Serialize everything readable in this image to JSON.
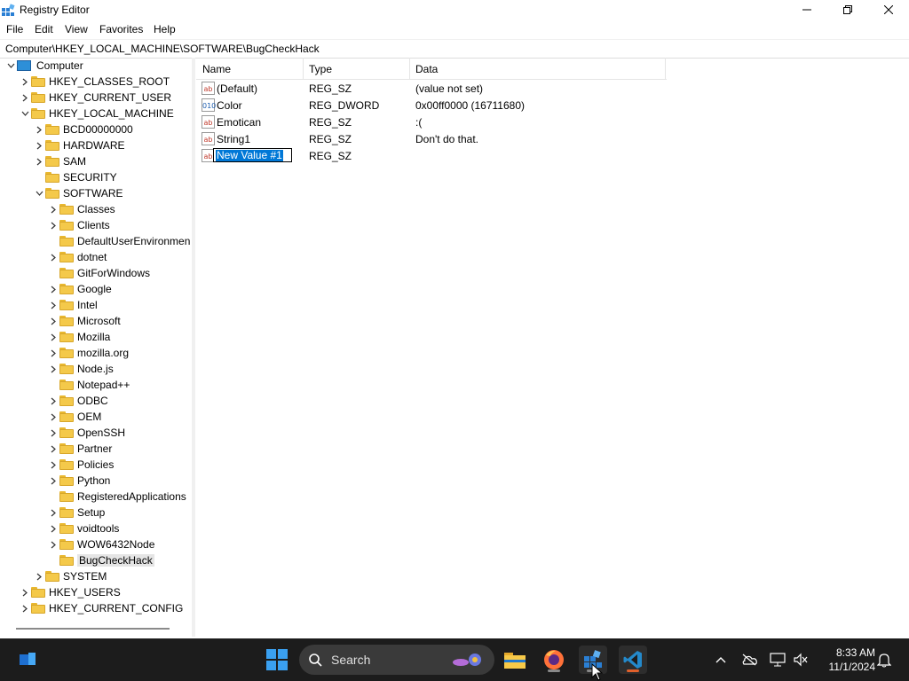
{
  "window": {
    "title": "Registry Editor"
  },
  "menu": [
    "File",
    "Edit",
    "View",
    "Favorites",
    "Help"
  ],
  "address": "Computer\\HKEY_LOCAL_MACHINE\\SOFTWARE\\BugCheckHack",
  "tree": [
    {
      "label": "Computer",
      "level": 0,
      "chevron": "expanded",
      "icon": "computer-icon"
    },
    {
      "label": "HKEY_CLASSES_ROOT",
      "level": 1,
      "chevron": "collapsed"
    },
    {
      "label": "HKEY_CURRENT_USER",
      "level": 1,
      "chevron": "collapsed"
    },
    {
      "label": "HKEY_LOCAL_MACHINE",
      "level": 1,
      "chevron": "expanded"
    },
    {
      "label": "BCD00000000",
      "level": 2,
      "chevron": "collapsed"
    },
    {
      "label": "HARDWARE",
      "level": 2,
      "chevron": "collapsed"
    },
    {
      "label": "SAM",
      "level": 2,
      "chevron": "collapsed"
    },
    {
      "label": "SECURITY",
      "level": 2,
      "chevron": "none"
    },
    {
      "label": "SOFTWARE",
      "level": 2,
      "chevron": "expanded"
    },
    {
      "label": "Classes",
      "level": 3,
      "chevron": "collapsed"
    },
    {
      "label": "Clients",
      "level": 3,
      "chevron": "collapsed"
    },
    {
      "label": "DefaultUserEnvironmen",
      "level": 3,
      "chevron": "none"
    },
    {
      "label": "dotnet",
      "level": 3,
      "chevron": "collapsed"
    },
    {
      "label": "GitForWindows",
      "level": 3,
      "chevron": "none"
    },
    {
      "label": "Google",
      "level": 3,
      "chevron": "collapsed"
    },
    {
      "label": "Intel",
      "level": 3,
      "chevron": "collapsed"
    },
    {
      "label": "Microsoft",
      "level": 3,
      "chevron": "collapsed"
    },
    {
      "label": "Mozilla",
      "level": 3,
      "chevron": "collapsed"
    },
    {
      "label": "mozilla.org",
      "level": 3,
      "chevron": "collapsed"
    },
    {
      "label": "Node.js",
      "level": 3,
      "chevron": "collapsed"
    },
    {
      "label": "Notepad++",
      "level": 3,
      "chevron": "none"
    },
    {
      "label": "ODBC",
      "level": 3,
      "chevron": "collapsed"
    },
    {
      "label": "OEM",
      "level": 3,
      "chevron": "collapsed"
    },
    {
      "label": "OpenSSH",
      "level": 3,
      "chevron": "collapsed"
    },
    {
      "label": "Partner",
      "level": 3,
      "chevron": "collapsed"
    },
    {
      "label": "Policies",
      "level": 3,
      "chevron": "collapsed"
    },
    {
      "label": "Python",
      "level": 3,
      "chevron": "collapsed"
    },
    {
      "label": "RegisteredApplications",
      "level": 3,
      "chevron": "none"
    },
    {
      "label": "Setup",
      "level": 3,
      "chevron": "collapsed"
    },
    {
      "label": "voidtools",
      "level": 3,
      "chevron": "collapsed"
    },
    {
      "label": "WOW6432Node",
      "level": 3,
      "chevron": "collapsed"
    },
    {
      "label": "BugCheckHack",
      "level": 3,
      "chevron": "none",
      "selected": true
    },
    {
      "label": "SYSTEM",
      "level": 2,
      "chevron": "collapsed"
    },
    {
      "label": "HKEY_USERS",
      "level": 1,
      "chevron": "collapsed"
    },
    {
      "label": "HKEY_CURRENT_CONFIG",
      "level": 1,
      "chevron": "collapsed"
    }
  ],
  "list": {
    "columns": [
      "Name",
      "Type",
      "Data"
    ],
    "rows": [
      {
        "icon": "string-value-icon",
        "glyph": "ab",
        "name": "(Default)",
        "type": "REG_SZ",
        "data": "(value not set)"
      },
      {
        "icon": "dword-value-icon",
        "glyph": "010",
        "name": "Color",
        "type": "REG_DWORD",
        "data": "0x00ff0000 (16711680)"
      },
      {
        "icon": "string-value-icon",
        "glyph": "ab",
        "name": "Emotican",
        "type": "REG_SZ",
        "data": ":("
      },
      {
        "icon": "string-value-icon",
        "glyph": "ab",
        "name": "String1",
        "type": "REG_SZ",
        "data": "Don't do that."
      }
    ],
    "editing": {
      "icon": "string-value-icon",
      "glyph": "ab",
      "name": "New Value #1",
      "type": "REG_SZ",
      "data": ""
    }
  },
  "taskbar": {
    "search_label": "Search",
    "apps": [
      "file-explorer-icon",
      "firefox-icon",
      "registry-editor-icon",
      "vscode-icon"
    ],
    "time": "8:33 AM",
    "date": "11/1/2024"
  }
}
